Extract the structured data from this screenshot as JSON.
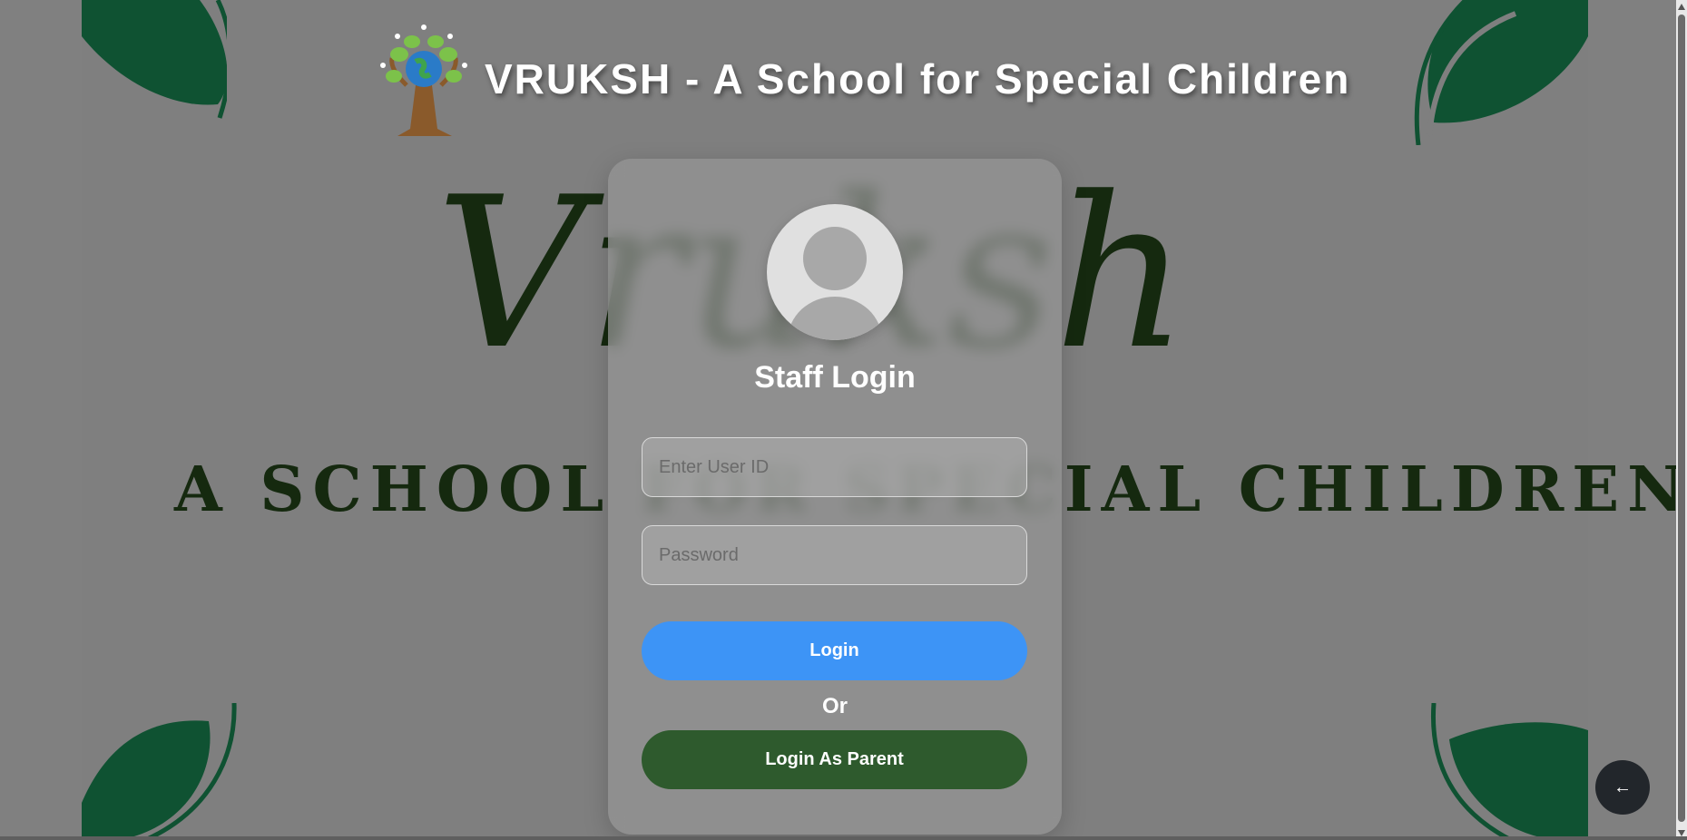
{
  "header": {
    "title": "VRUKSH - A School for Special Children"
  },
  "background": {
    "script_word": "Vruksh",
    "tagline": "A SCHOOL FOR SPECIAL CHILDREN"
  },
  "login_card": {
    "title": "Staff Login",
    "user_id": {
      "placeholder": "Enter User ID",
      "value": ""
    },
    "password": {
      "placeholder": "Password",
      "value": ""
    },
    "login_label": "Login",
    "or_label": "Or",
    "parent_login_label": "Login As Parent"
  },
  "back_button": {
    "icon": "arrow-left-icon",
    "glyph": "←"
  },
  "colors": {
    "overlay": "#808080",
    "leaf": "#0f5232",
    "primary_button": "#3d94f6",
    "parent_button": "#2e5a2d",
    "back_button": "#22262b"
  }
}
